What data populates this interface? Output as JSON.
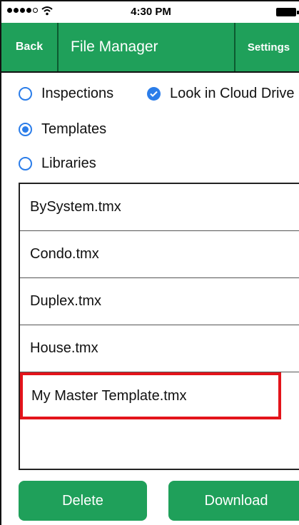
{
  "status_bar": {
    "time": "4:30 PM"
  },
  "nav": {
    "back_label": "Back",
    "title": "File Manager",
    "settings_label": "Settings"
  },
  "options": {
    "inspections": "Inspections",
    "cloud": "Look in Cloud Drive",
    "templates": "Templates",
    "libraries": "Libraries"
  },
  "selected_option": "Templates",
  "files": [
    "BySystem.tmx",
    "Condo.tmx",
    "Duplex.tmx",
    "House.tmx",
    "My Master Template.tmx"
  ],
  "buttons": {
    "delete": "Delete",
    "download": "Download"
  },
  "colors": {
    "accent": "#1fa05a",
    "radio": "#2b7de9",
    "highlight": "#e3141b"
  }
}
